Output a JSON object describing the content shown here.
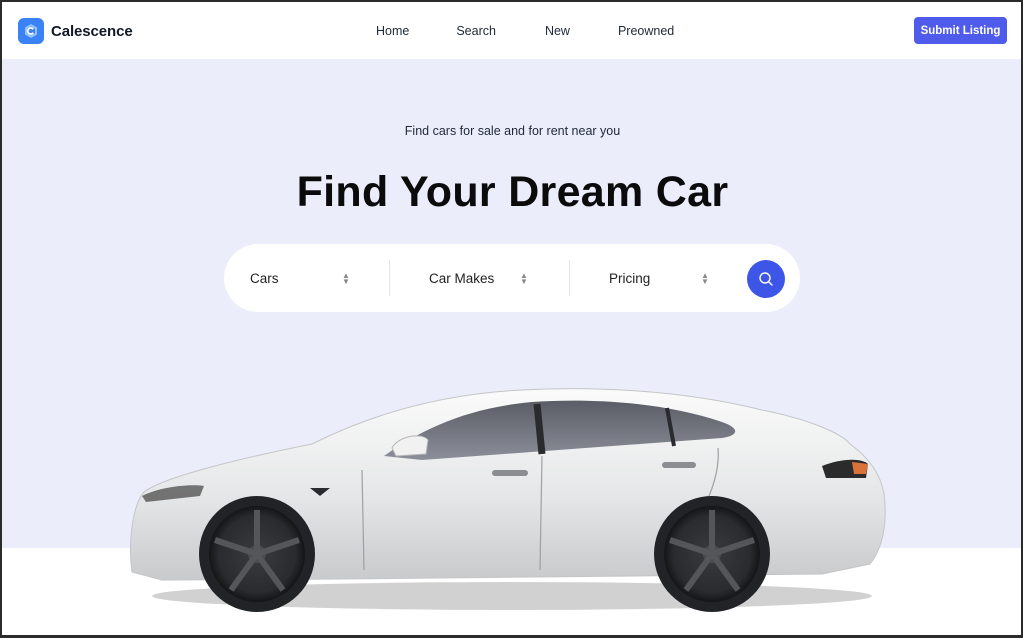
{
  "brand": {
    "name": "Calescence"
  },
  "nav": {
    "links": [
      "Home",
      "Search",
      "New",
      "Preowned"
    ],
    "cta": "Submit Listing"
  },
  "hero": {
    "tagline": "Find cars for sale and for rent near you",
    "headline": "Find Your Dream Car"
  },
  "search": {
    "filters": [
      {
        "label": "Cars"
      },
      {
        "label": "Car Makes"
      },
      {
        "label": "Pricing"
      }
    ]
  },
  "colors": {
    "accent": "#4f5bea",
    "hero_bg": "#ecedfb",
    "logo": "#3b82f6"
  }
}
